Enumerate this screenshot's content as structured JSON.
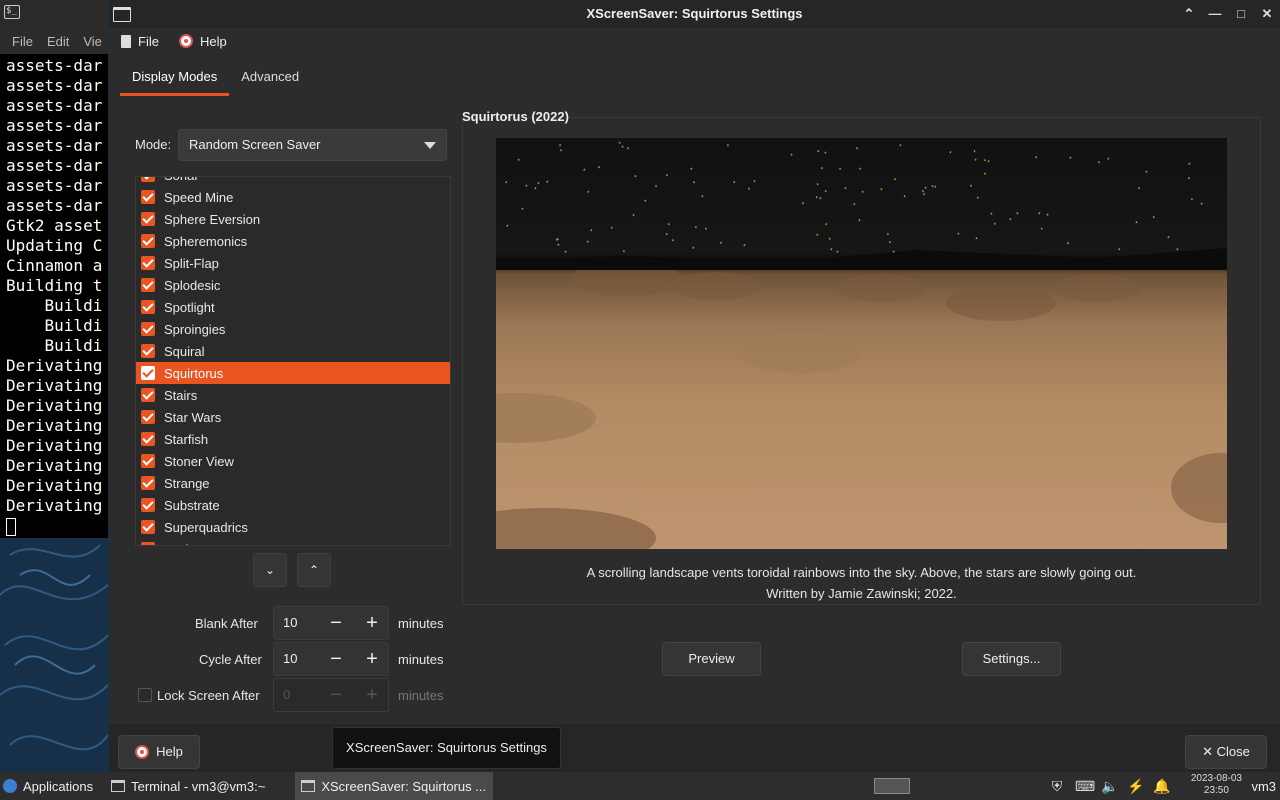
{
  "terminal": {
    "menu": [
      "File",
      "Edit",
      "Vie"
    ],
    "lines": [
      "assets-dar",
      "assets-dar",
      "assets-dar",
      "assets-dar",
      "assets-dar",
      "assets-dar",
      "assets-dar",
      "assets-dar",
      "Gtk2 asset",
      "Updating C",
      "Cinnamon a",
      "Building t",
      "    Buildi",
      "    Buildi",
      "    Buildi",
      "Derivating",
      "Derivating",
      "Derivating",
      "Derivating",
      "Derivating",
      "Derivating",
      "Derivating",
      "Derivating"
    ]
  },
  "window": {
    "title": "XScreenSaver: Squirtorus Settings",
    "menu": {
      "file": "File",
      "help": "Help"
    },
    "tabs": [
      {
        "label": "Display Modes"
      },
      {
        "label": "Advanced"
      }
    ]
  },
  "mode": {
    "label": "Mode:",
    "value": "Random Screen Saver"
  },
  "savers": [
    {
      "name": "Sonar",
      "selected": false
    },
    {
      "name": "Speed Mine",
      "selected": false
    },
    {
      "name": "Sphere Eversion",
      "selected": false
    },
    {
      "name": "Spheremonics",
      "selected": false
    },
    {
      "name": "Split-Flap",
      "selected": false
    },
    {
      "name": "Splodesic",
      "selected": false
    },
    {
      "name": "Spotlight",
      "selected": false
    },
    {
      "name": "Sproingies",
      "selected": false
    },
    {
      "name": "Squiral",
      "selected": false
    },
    {
      "name": "Squirtorus",
      "selected": true
    },
    {
      "name": "Stairs",
      "selected": false
    },
    {
      "name": "Star Wars",
      "selected": false
    },
    {
      "name": "Starfish",
      "selected": false
    },
    {
      "name": "Stoner View",
      "selected": false
    },
    {
      "name": "Strange",
      "selected": false
    },
    {
      "name": "Substrate",
      "selected": false
    },
    {
      "name": "Superquadrics",
      "selected": false
    },
    {
      "name": "Surfaces",
      "selected": false
    }
  ],
  "timing": {
    "blank_label": "Blank After",
    "blank_value": "10",
    "cycle_label": "Cycle After",
    "cycle_value": "10",
    "lock_label": "Lock Screen After",
    "lock_value": "0",
    "unit": "minutes"
  },
  "demo": {
    "title": "Squirtorus (2022)",
    "description": "A scrolling landscape vents toroidal rainbows into the sky. Above, the stars are slowly going out.",
    "credit": "Written by Jamie Zawinski; 2022."
  },
  "buttons": {
    "preview": "Preview",
    "settings": "Settings...",
    "help": "Help",
    "close": "Close"
  },
  "tooltip": "XScreenSaver: Squirtorus Settings",
  "taskbar": {
    "applications": "Applications",
    "items": [
      {
        "label": "Terminal - vm3@vm3:~"
      },
      {
        "label": "XScreenSaver: Squirtorus ..."
      }
    ],
    "clock_date": "2023-08-03",
    "clock_time": "23:50",
    "user": "vm3"
  },
  "colors": {
    "accent": "#e95420"
  }
}
